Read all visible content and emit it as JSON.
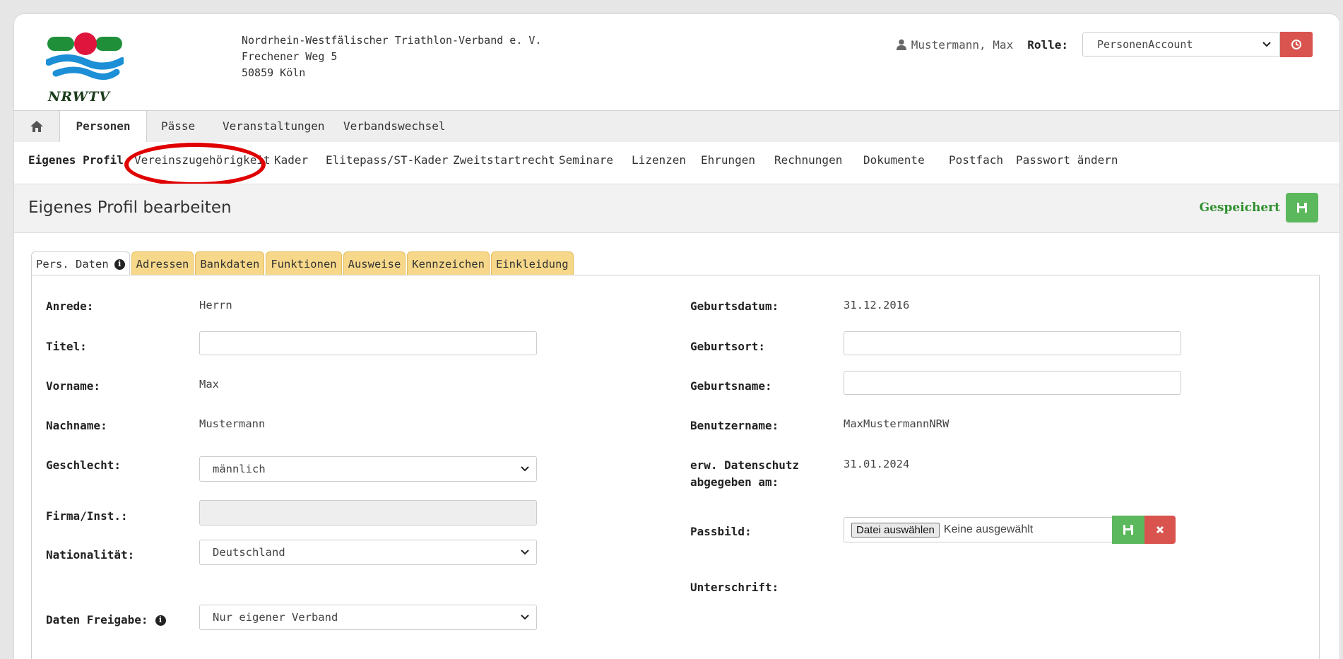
{
  "org": {
    "logo_text": "NRWTV",
    "name": "Nordrhein-Westfälischer Triathlon-Verband e. V.",
    "street": "Frechener Weg 5",
    "city": "50859 Köln"
  },
  "user": {
    "name": "Mustermann, Max",
    "role_label": "Rolle:",
    "role_value": "PersonenAccount"
  },
  "main_nav": [
    "Personen",
    "Pässe",
    "Veranstaltungen",
    "Verbandswechsel"
  ],
  "sub_nav": [
    "Eigenes Profil",
    "Vereinszugehörigkeit",
    "Kader",
    "Elitepass/ST-Kader",
    "Zweitstartrecht",
    "Seminare",
    "Lizenzen",
    "Ehrungen",
    "Rechnungen",
    "Dokumente",
    "Postfach",
    "Passwort ändern"
  ],
  "page": {
    "title": "Eigenes Profil bearbeiten",
    "saved_label": "Gespeichert"
  },
  "tabs": [
    "Pers. Daten",
    "Adressen",
    "Bankdaten",
    "Funktionen",
    "Ausweise",
    "Kennzeichen",
    "Einkleidung"
  ],
  "form": {
    "anrede_label": "Anrede:",
    "anrede_value": "Herrn",
    "titel_label": "Titel:",
    "titel_value": "",
    "vorname_label": "Vorname:",
    "vorname_value": "Max",
    "nachname_label": "Nachname:",
    "nachname_value": "Mustermann",
    "geschlecht_label": "Geschlecht:",
    "geschlecht_value": "männlich",
    "firma_label": "Firma/Inst.:",
    "nationalitaet_label": "Nationalität:",
    "nationalitaet_value": "Deutschland",
    "freigabe_label": "Daten Freigabe:",
    "freigabe_value": "Nur eigener Verband",
    "geburtsdatum_label": "Geburtsdatum:",
    "geburtsdatum_value": "31.12.2016",
    "geburtsort_label": "Geburtsort:",
    "geburtsname_label": "Geburtsname:",
    "benutzername_label": "Benutzername:",
    "benutzername_value": "MaxMustermannNRW",
    "datenschutz_label_1": "erw. Datenschutz",
    "datenschutz_label_2": "abgegeben am:",
    "datenschutz_value": "31.01.2024",
    "passbild_label": "Passbild:",
    "file_button": "Datei auswählen",
    "file_status": "Keine ausgewählt",
    "unterschrift_label": "Unterschrift:"
  },
  "colors": {
    "accent_red": "#d9534f",
    "accent_green": "#5cb85c",
    "tab_yellow": "#f7d88a",
    "highlight": "#e00000"
  }
}
